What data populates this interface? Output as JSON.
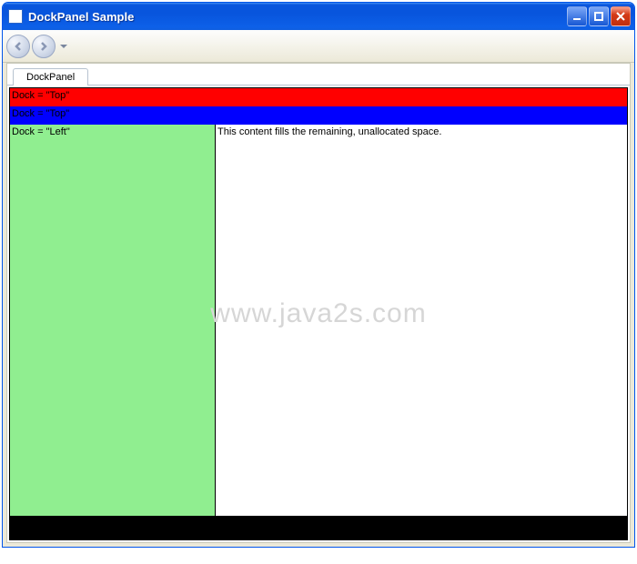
{
  "window": {
    "title": "DockPanel Sample"
  },
  "toolbar": {
    "back": "back",
    "forward": "forward"
  },
  "tabs": [
    {
      "label": "DockPanel"
    }
  ],
  "dock": {
    "top1": "Dock = \"Top\"",
    "top2": "Dock = \"Top\"",
    "left": "Dock = \"Left\"",
    "fill": "This content fills the remaining, unallocated space."
  },
  "watermark": "www.java2s.com"
}
